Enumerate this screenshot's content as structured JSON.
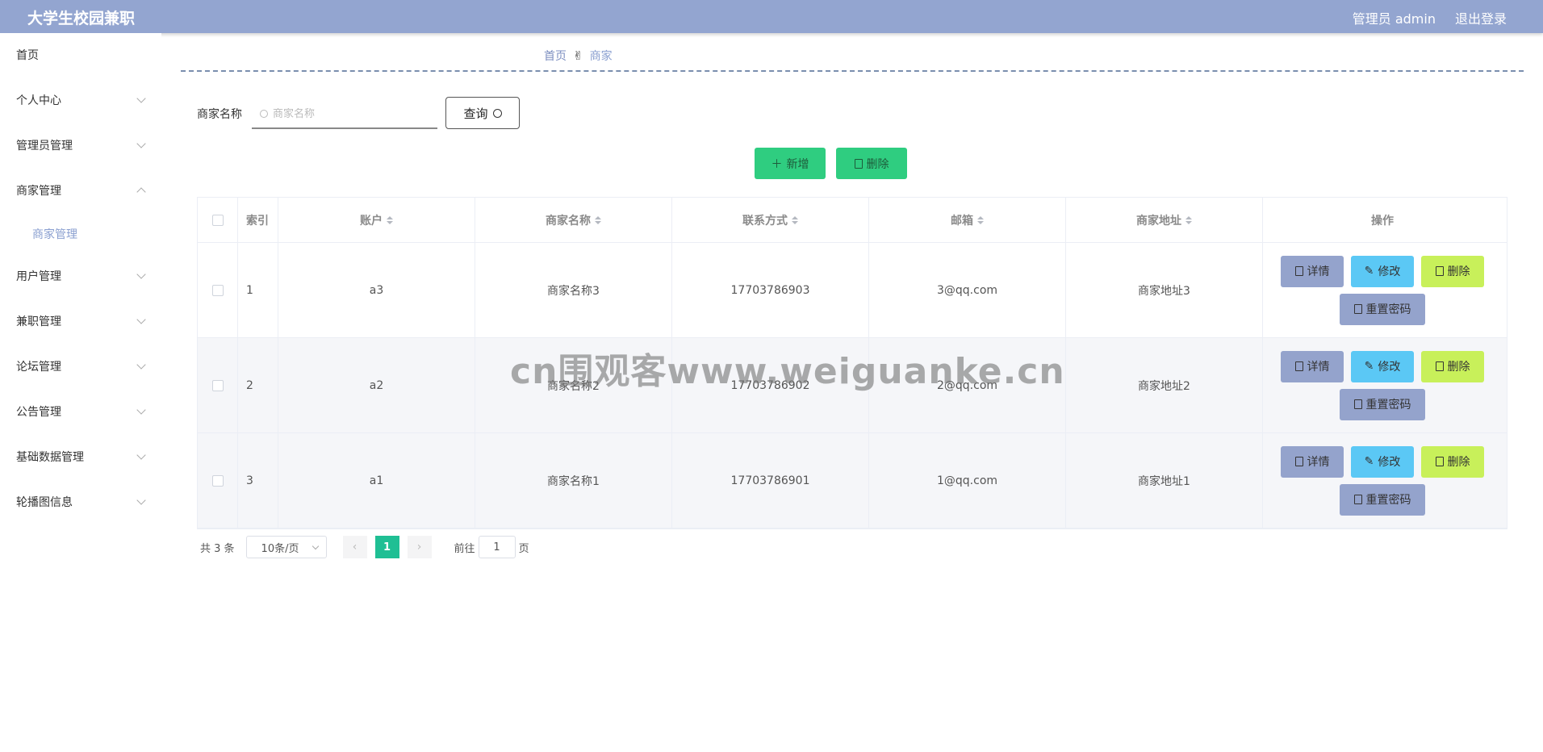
{
  "header": {
    "app_title": "大学生校园兼职",
    "admin_label": "管理员 admin",
    "logout_label": "退出登录"
  },
  "sidebar": {
    "items": [
      {
        "label": "首页"
      },
      {
        "label": "个人中心"
      },
      {
        "label": "管理员管理"
      },
      {
        "label": "商家管理"
      },
      {
        "label": "用户管理"
      },
      {
        "label": "兼职管理"
      },
      {
        "label": "论坛管理"
      },
      {
        "label": "公告管理"
      },
      {
        "label": "基础数据管理"
      },
      {
        "label": "轮播图信息"
      }
    ],
    "sub_item": "商家管理"
  },
  "breadcrumb": {
    "home": "首页",
    "separator": "✌",
    "current": "商家"
  },
  "search": {
    "label": "商家名称",
    "placeholder": "商家名称",
    "query_label": "查询"
  },
  "toolbar": {
    "add_label": "新增",
    "delete_label": "删除"
  },
  "table": {
    "headers": {
      "index": "索引",
      "account": "账户",
      "name": "商家名称",
      "phone": "联系方式",
      "email": "邮箱",
      "address": "商家地址",
      "ops": "操作"
    },
    "rows": [
      {
        "index": "1",
        "account": "a3",
        "name": "商家名称3",
        "phone": "17703786903",
        "email": "3@qq.com",
        "address": "商家地址3"
      },
      {
        "index": "2",
        "account": "a2",
        "name": "商家名称2",
        "phone": "17703786902",
        "email": "2@qq.com",
        "address": "商家地址2"
      },
      {
        "index": "3",
        "account": "a1",
        "name": "商家名称1",
        "phone": "17703786901",
        "email": "1@qq.com",
        "address": "商家地址1"
      }
    ],
    "ops": {
      "detail": "详情",
      "edit": "修改",
      "delete": "删除",
      "reset": "重置密码"
    }
  },
  "pagination": {
    "total": "共 3 条",
    "page_size": "10条/页",
    "current_page": "1",
    "goto_label": "前往",
    "goto_value": "1",
    "page_suffix": "页"
  },
  "watermark": "cn围观客www.weiguanke.cn"
}
